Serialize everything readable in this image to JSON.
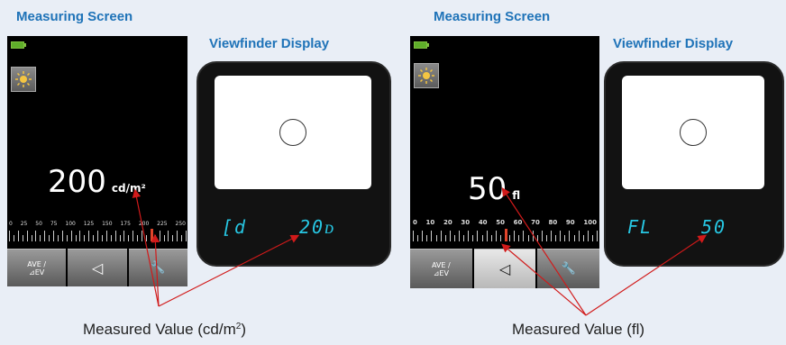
{
  "left": {
    "title": "Measuring Screen",
    "viewfinder_title": "Viewfinder Display",
    "battery_label": "Battery",
    "value": "200",
    "unit": "cd/m²",
    "scale": [
      "0",
      "25",
      "50",
      "75",
      "100",
      "125",
      "150",
      "175",
      "200",
      "225",
      "250"
    ],
    "buttons": {
      "ave": "AVE /",
      "ev": "⊿EV",
      "back": "◁",
      "tool": "🔧"
    },
    "vf_mode": "[d",
    "vf_value": "20ᴅ",
    "caption_prefix": "Measured Value (cd/m",
    "caption_sup": "2",
    "caption_suffix": ")"
  },
  "right": {
    "title": "Measuring Screen",
    "viewfinder_title": "Viewfinder Display",
    "value": "50",
    "unit": "fl",
    "scale": [
      "0",
      "10",
      "20",
      "30",
      "40",
      "50",
      "60",
      "70",
      "80",
      "90",
      "100"
    ],
    "buttons": {
      "ave": "AVE /",
      "ev": "⊿EV",
      "back": "◁",
      "tool": "🔧"
    },
    "vf_mode": "FL",
    "vf_value": "50",
    "caption": "Measured Value (fl)"
  },
  "colors": {
    "accent": "#1f73b8",
    "segment": "#27c7e3",
    "arrow": "#d11a1a"
  },
  "icons": [
    "battery-icon",
    "sun-icon",
    "back-arrow-icon",
    "wrench-icon"
  ]
}
